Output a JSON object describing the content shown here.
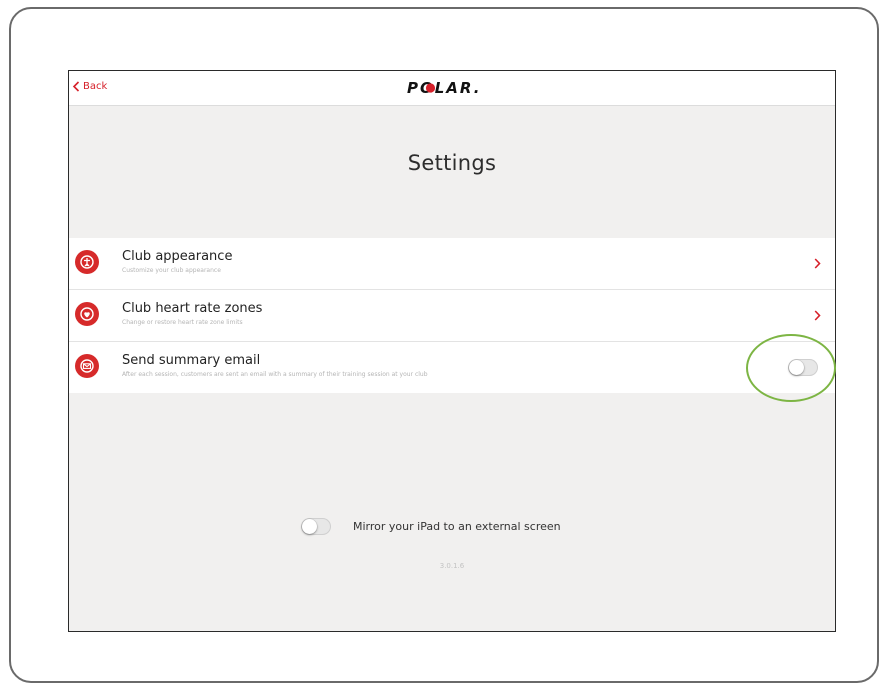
{
  "navbar": {
    "back_label": "Back",
    "logo_text": "POLAR."
  },
  "page_title": "Settings",
  "settings": [
    {
      "title": "Club appearance",
      "subtitle": "Customize your club appearance",
      "control": "chevron",
      "icon": "club-appearance-icon"
    },
    {
      "title": "Club heart rate zones",
      "subtitle": "Change or restore heart rate zone limits",
      "control": "chevron",
      "icon": "heart-rate-zones-icon"
    },
    {
      "title": "Send summary email",
      "subtitle": "After each session, customers are sent an email with a summary of their training session at your club",
      "control": "toggle",
      "toggle_on": false,
      "icon": "summary-email-icon"
    }
  ],
  "mirror": {
    "label": "Mirror your iPad to an external screen",
    "toggle_on": false
  },
  "version": "3.0.1.6",
  "colors": {
    "accent": "#d6202a",
    "icon_bg": "#d62a2a",
    "highlight": "#7db544",
    "screen_bg": "#f1f0ef"
  }
}
